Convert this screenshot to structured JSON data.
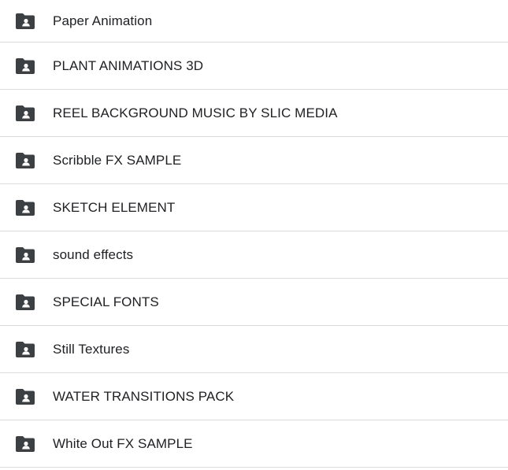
{
  "folders": [
    {
      "name": "Paper Animation",
      "icon": "shared-folder-icon"
    },
    {
      "name": "PLANT ANIMATIONS 3D",
      "icon": "shared-folder-icon"
    },
    {
      "name": "REEL BACKGROUND MUSIC BY SLIC MEDIA",
      "icon": "shared-folder-icon"
    },
    {
      "name": "Scribble FX SAMPLE",
      "icon": "shared-folder-icon"
    },
    {
      "name": "SKETCH ELEMENT",
      "icon": "shared-folder-icon"
    },
    {
      "name": "sound effects",
      "icon": "shared-folder-icon"
    },
    {
      "name": "SPECIAL FONTS",
      "icon": "shared-folder-icon"
    },
    {
      "name": "Still Textures",
      "icon": "shared-folder-icon"
    },
    {
      "name": "WATER TRANSITIONS PACK",
      "icon": "shared-folder-icon"
    },
    {
      "name": "White Out FX SAMPLE",
      "icon": "shared-folder-icon"
    }
  ],
  "colors": {
    "icon": "#3c4043",
    "text": "#202124",
    "divider": "#dadce0"
  }
}
